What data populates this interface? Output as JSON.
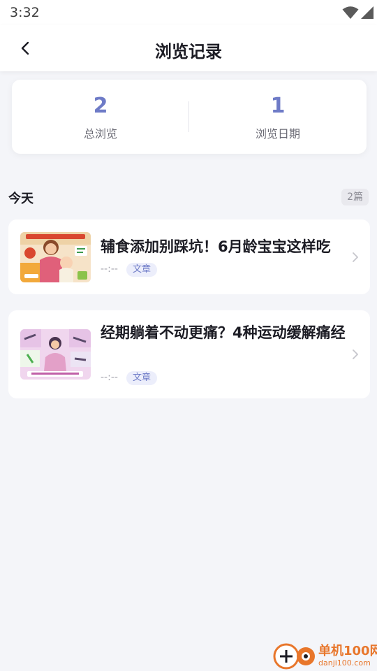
{
  "status_bar": {
    "time": "3:32",
    "icons": [
      "wifi-icon",
      "cellular-signal-icon",
      "battery-charging-icon"
    ]
  },
  "header": {
    "title": "浏览记录",
    "back_icon": "chevron-left-icon"
  },
  "stats": {
    "total_views": {
      "value": "2",
      "label": "总浏览"
    },
    "view_days": {
      "value": "1",
      "label": "浏览日期"
    }
  },
  "section": {
    "title": "今天",
    "count": "2篇"
  },
  "articles": [
    {
      "title": "辅食添加别踩坑！6月龄宝宝这样吃",
      "time": "--:--",
      "tag": "文章",
      "thumbnail": "mother-feeding-baby-illustration"
    },
    {
      "title": "经期躺着不动更痛？4种运动缓解痛经",
      "time": "--:--",
      "tag": "文章",
      "thumbnail": "woman-exercise-illustration"
    }
  ],
  "watermark": {
    "name": "单机100网",
    "url": "danji100.com"
  },
  "colors": {
    "accent": "#6e7bc7",
    "background": "#f4f5f9",
    "card": "#ffffff",
    "tag_bg": "#eceefb"
  }
}
